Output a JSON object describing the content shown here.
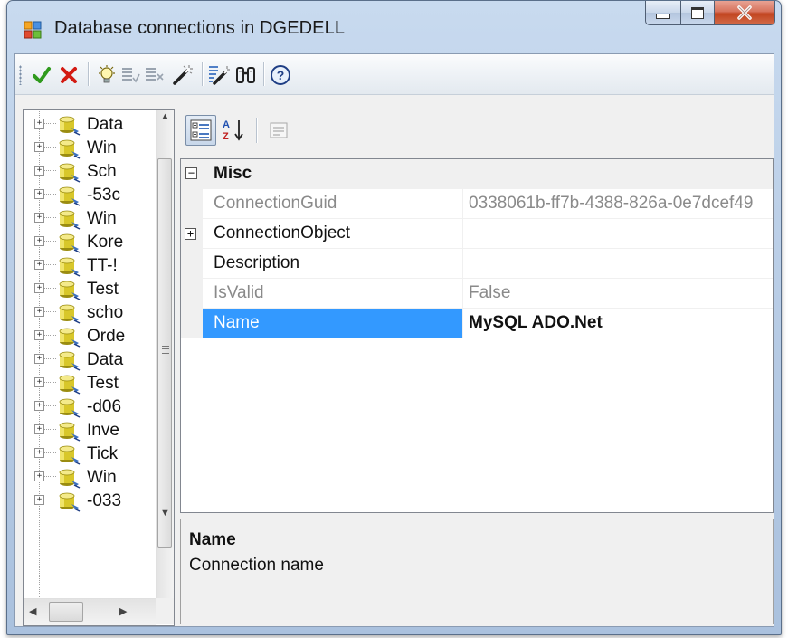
{
  "window": {
    "title": "Database connections in DGEDELL"
  },
  "toolbar": {
    "buttons": [
      {
        "name": "ok-button",
        "icon": "checkmark-icon"
      },
      {
        "name": "cancel-button",
        "icon": "red-x-icon"
      },
      {
        "name": "new-connection-button",
        "icon": "lightbulb-icon"
      },
      {
        "name": "validate-button",
        "icon": "list-check-icon"
      },
      {
        "name": "remove-button",
        "icon": "list-remove-icon"
      },
      {
        "name": "edit-button",
        "icon": "magic-wand-icon"
      },
      {
        "name": "wizard-button",
        "icon": "wand-list-icon"
      },
      {
        "name": "find-button",
        "icon": "binoculars-icon"
      },
      {
        "name": "help-button",
        "icon": "help-icon"
      }
    ]
  },
  "tree": {
    "items": [
      {
        "label": "Data"
      },
      {
        "label": "Win"
      },
      {
        "label": "Sch"
      },
      {
        "label": "-53c"
      },
      {
        "label": "Win"
      },
      {
        "label": "Kore"
      },
      {
        "label": "TT-!"
      },
      {
        "label": "Test"
      },
      {
        "label": "scho"
      },
      {
        "label": "Orde"
      },
      {
        "label": "Data"
      },
      {
        "label": "Test"
      },
      {
        "label": "-d06"
      },
      {
        "label": "Inve"
      },
      {
        "label": "Tick"
      },
      {
        "label": "Win"
      },
      {
        "label": "-033"
      }
    ]
  },
  "property_grid": {
    "category": "Misc",
    "rows": [
      {
        "name": "ConnectionGuid",
        "value": "0338061b-ff7b-4388-826a-0e7dcef49",
        "readonly": true
      },
      {
        "name": "ConnectionObject",
        "value": "",
        "expandable": true
      },
      {
        "name": "Description",
        "value": ""
      },
      {
        "name": "IsValid",
        "value": "False",
        "readonly": true
      },
      {
        "name": "Name",
        "value": "MySQL ADO.Net",
        "selected": true
      }
    ],
    "description": {
      "title": "Name",
      "text": "Connection name"
    }
  },
  "colors": {
    "selection": "#3399ff",
    "readonly_text": "#8a8a8a"
  }
}
